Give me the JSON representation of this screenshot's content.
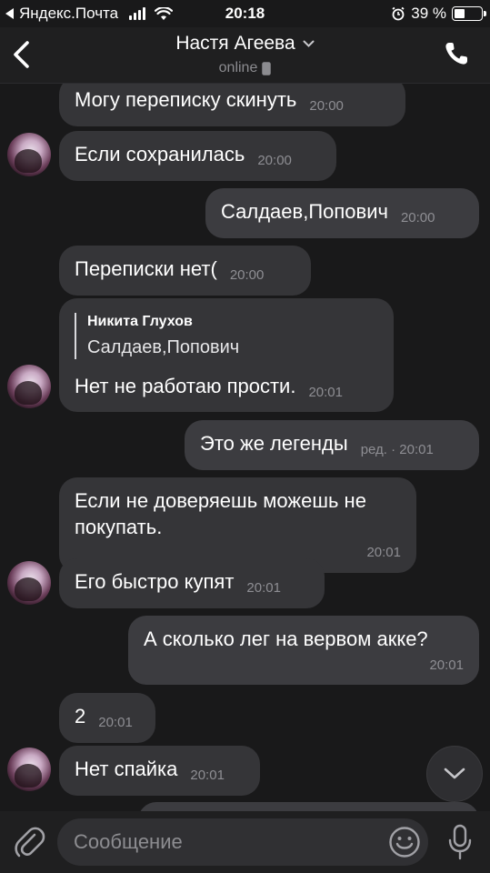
{
  "status_bar": {
    "carrier": "Яндекс.Почта",
    "time": "20:18",
    "battery": "39 %",
    "battery_level": 0.39
  },
  "header": {
    "contact_name": "Настя Агеева",
    "status": "online"
  },
  "messages": [
    {
      "text": "Могу переписку скинуть",
      "time": "20:00"
    },
    {
      "text": "Если сохранилась",
      "time": "20:00"
    },
    {
      "text": "Салдаев,Попович",
      "time": "20:00"
    },
    {
      "text": "Переписки нет(",
      "time": "20:00"
    },
    {
      "quote_author": "Никита Глухов",
      "quote_text": "Салдаев,Попович",
      "text": "Нет не работаю прости.",
      "time": "20:01"
    },
    {
      "text": "Это же легенды",
      "time": "ред. · 20:01"
    },
    {
      "text": "Если не доверяешь можешь не покупать.",
      "time": "20:01"
    },
    {
      "text": "Его быстро купят",
      "time": "20:01"
    },
    {
      "text": "А сколько лег на вервом акке?",
      "time": "20:01"
    },
    {
      "text": "2",
      "time": "20:01"
    },
    {
      "text": "Нет спайка",
      "time": "20:01"
    }
  ],
  "input": {
    "placeholder": "Сообщение"
  },
  "icons": [
    "back-chevron",
    "phone",
    "chevron-down",
    "paperclip",
    "smile",
    "microphone"
  ]
}
